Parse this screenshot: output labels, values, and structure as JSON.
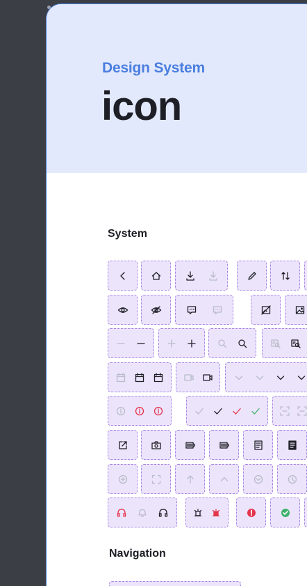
{
  "header": {
    "eyebrow": "Design System",
    "title": "icon"
  },
  "sections": {
    "system": "System",
    "navigation": "Navigation"
  },
  "colors": {
    "hero_bg": "#e3e9fc",
    "accent": "#4a7fe0",
    "cell_bg": "#ece4fb",
    "cell_border": "#a886e8",
    "icon_dark": "#1e1f26",
    "icon_light": "#b8bcc8",
    "danger": "#e5354d",
    "success": "#3fb16b"
  },
  "icons": [
    "chevron-left-icon",
    "home-icon",
    "download-icon",
    "edit-icon",
    "sort-icon",
    "view-icon",
    "hide-icon",
    "comment-icon",
    "image-off-icon",
    "image-icon",
    "minus-icon",
    "plus-icon",
    "search-icon",
    "search-doc-icon",
    "calendar-icon",
    "video-icon",
    "chevron-down-icon",
    "info-icon",
    "check-icon",
    "scan-icon",
    "external-link-icon",
    "camera-icon",
    "barcode-icon",
    "document-icon",
    "add-circle-icon",
    "fullscreen-icon",
    "arrow-up-icon",
    "chevron-up-icon",
    "chevron-down-circle-icon",
    "clock-icon",
    "headset-icon",
    "bell-icon",
    "siren-icon",
    "error-icon",
    "success-icon"
  ]
}
